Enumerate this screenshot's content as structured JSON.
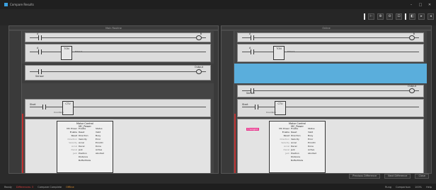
{
  "window": {
    "title": "Compare Results",
    "buttons": [
      "–",
      "□",
      "✕"
    ]
  },
  "toolbar": {
    "buttons": [
      "⊢",
      "⊕",
      "⊖",
      "⊡",
      "◧",
      "▸",
      "◂"
    ]
  },
  "left_pane": {
    "header": "Main Routine",
    "rungs": [
      {
        "contact_tag": "A",
        "coil_tag": "B"
      },
      {
        "contact_tag": "A",
        "block_title": "TON",
        "block_tag": "Timer1"
      },
      {
        "contact_tag": "Sensor",
        "coil_tag": "Output"
      },
      {
        "contact_tag": "Start",
        "block_title": "CTU",
        "block_tag": "Counter1"
      }
    ],
    "fb": {
      "title": "Motor Control",
      "subtitle": "MC_Power",
      "in_labels": [
        "MC Power",
        "Enable",
        "Reset",
        "Direction",
        "Velocity",
        "Accel",
        "Decel",
        "Jerk",
        "Position",
        "Distance",
        "BufferMode"
      ],
      "out_labels": [
        "Status",
        "Valid",
        "Busy",
        "Error",
        "ErrorID",
        "Done",
        "Active",
        "Aborted"
      ]
    }
  },
  "right_pane": {
    "header": "Online",
    "rungs": [
      {
        "contact_tag": "A",
        "coil_tag": "B"
      },
      {
        "contact_tag": "A",
        "block_title": "TON",
        "block_tag": "Timer1"
      },
      {
        "contact_tag": "Sensor",
        "coil_tag": "Output"
      },
      {
        "contact_tag": "Start",
        "block_title": "CTU",
        "block_tag": "Counter1"
      }
    ],
    "fb": {
      "title": "Motor Control",
      "subtitle": "MC_Power",
      "highlight_tag": "Changed",
      "in_labels": [
        "MC Power",
        "Enable",
        "Reset",
        "Direction",
        "Velocity",
        "Accel",
        "Decel",
        "Jerk",
        "Position",
        "Distance",
        "BufferMode"
      ],
      "out_labels": [
        "Status",
        "Valid",
        "Busy",
        "Error",
        "ErrorID",
        "Done",
        "Active",
        "Aborted"
      ]
    }
  },
  "bottom_buttons": [
    "Previous Difference",
    "Next Difference",
    "Close"
  ],
  "status": {
    "left": [
      "Ready",
      "Differences: 3",
      "Compare Complete",
      "Offline"
    ],
    "right": [
      "Rung",
      "Comparison",
      "100%",
      "Help"
    ]
  },
  "colors": {
    "highlight": "#5aaedc",
    "diff_marker": "#e8308a",
    "rail": "#c03030"
  }
}
